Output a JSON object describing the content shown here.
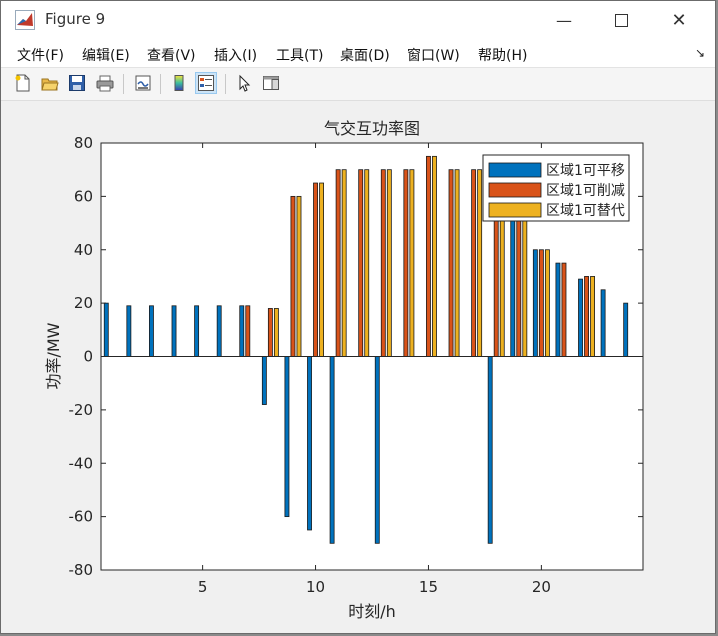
{
  "window": {
    "title": "Figure 9",
    "minimize_icon": "minimize-icon",
    "maximize_icon": "maximize-icon",
    "close_icon": "close-icon"
  },
  "menu": [
    {
      "label": "文件(F)",
      "underline": "F"
    },
    {
      "label": "编辑(E)",
      "underline": "E"
    },
    {
      "label": "查看(V)",
      "underline": "V"
    },
    {
      "label": "插入(I)",
      "underline": "I"
    },
    {
      "label": "工具(T)",
      "underline": "T"
    },
    {
      "label": "桌面(D)",
      "underline": "D"
    },
    {
      "label": "窗口(W)",
      "underline": "W"
    },
    {
      "label": "帮助(H)",
      "underline": "H"
    }
  ],
  "toolbar": [
    "new-figure-icon",
    "open-file-icon",
    "save-icon",
    "print-icon",
    "link-plot-icon",
    "colorbar-icon",
    "legend-icon",
    "pointer-icon",
    "property-editor-icon"
  ],
  "chart_data": {
    "type": "bar",
    "title": "气交互功率图",
    "xlabel": "时刻/h",
    "ylabel": "功率/MW",
    "xlim": [
      0.5,
      24.5
    ],
    "ylim": [
      -80,
      80
    ],
    "xticks": [
      5,
      10,
      15,
      20
    ],
    "yticks": [
      -80,
      -60,
      -40,
      -20,
      0,
      20,
      40,
      60,
      80
    ],
    "legend_position": "top-right",
    "x": [
      1,
      2,
      3,
      4,
      5,
      6,
      7,
      8,
      9,
      10,
      11,
      12,
      13,
      14,
      15,
      16,
      17,
      18,
      19,
      20,
      21,
      22,
      23,
      24
    ],
    "series": [
      {
        "name": "区域1可平移",
        "color": "#0072BD",
        "values": [
          20,
          19,
          19,
          19,
          19,
          19,
          19,
          -18,
          -60,
          -65,
          -70,
          0,
          -70,
          0,
          0,
          0,
          0,
          -70,
          55,
          40,
          35,
          29,
          25,
          20
        ]
      },
      {
        "name": "区域1可削减",
        "color": "#D95319",
        "values": [
          0,
          0,
          0,
          0,
          0,
          0,
          19,
          18,
          60,
          65,
          70,
          70,
          70,
          70,
          75,
          70,
          70,
          70,
          55,
          40,
          35,
          30,
          0,
          0
        ]
      },
      {
        "name": "区域1可替代",
        "color": "#EDB120",
        "values": [
          0,
          0,
          0,
          0,
          0,
          0,
          0,
          18,
          60,
          65,
          70,
          70,
          70,
          70,
          75,
          70,
          70,
          70,
          55,
          40,
          0,
          30,
          0,
          0
        ]
      }
    ]
  }
}
